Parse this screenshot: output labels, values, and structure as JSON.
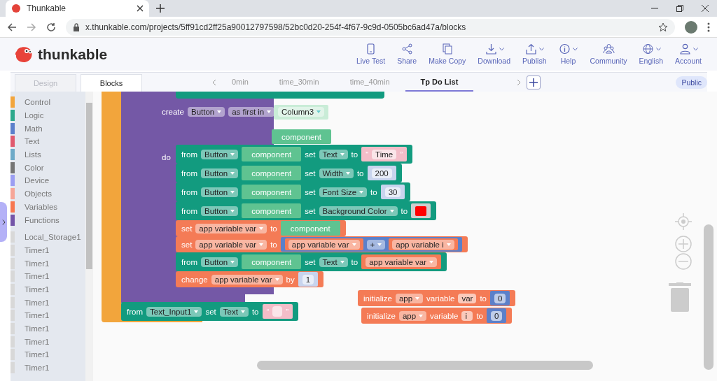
{
  "browser": {
    "tab_title": "Thunkable",
    "url": "x.thunkable.com/projects/5ff91cd2ff25a90012797598/52bc0d20-254f-4f67-9c9d-0505bc6ad47a/blocks"
  },
  "header": {
    "logo": "thunkable",
    "actions": [
      {
        "label": "Live Test",
        "dropdown": false
      },
      {
        "label": "Share",
        "dropdown": false
      },
      {
        "label": "Make Copy",
        "dropdown": false
      },
      {
        "label": "Download",
        "dropdown": true
      },
      {
        "label": "Publish",
        "dropdown": true
      },
      {
        "label": "Help",
        "dropdown": true
      },
      {
        "label": "Community",
        "dropdown": false
      },
      {
        "label": "English",
        "dropdown": true
      },
      {
        "label": "Account",
        "dropdown": true
      }
    ]
  },
  "modes": [
    {
      "label": "Design",
      "selected": false
    },
    {
      "label": "Blocks",
      "selected": true
    }
  ],
  "screens": [
    {
      "label": "0min",
      "selected": false
    },
    {
      "label": "time_30min",
      "selected": false
    },
    {
      "label": "time_40min",
      "selected": false
    },
    {
      "label": "Tp Do List",
      "selected": true
    }
  ],
  "visibility": "Public",
  "sidebar": {
    "categories": [
      {
        "label": "Control",
        "color": "#f2a53c"
      },
      {
        "label": "Logic",
        "color": "#2ea88c"
      },
      {
        "label": "Math",
        "color": "#5b7fcb"
      },
      {
        "label": "Text",
        "color": "#e05a6e"
      },
      {
        "label": "Lists",
        "color": "#6eaac8"
      },
      {
        "label": "Color",
        "color": "#757575"
      },
      {
        "label": "Device",
        "color": "#9b9ef2"
      },
      {
        "label": "Objects",
        "color": "#f6a698"
      },
      {
        "label": "Variables",
        "color": "#f77750"
      },
      {
        "label": "Functions",
        "color": "#7455a8"
      }
    ],
    "components": [
      "Local_Storage1",
      "Timer1",
      "Timer1",
      "Timer1",
      "Timer1",
      "Timer1",
      "Timer1",
      "Timer1",
      "Timer1",
      "Timer1",
      "Timer1"
    ]
  },
  "canvas": {
    "create_block": {
      "header": [
        {
          "kind": "label",
          "text": "create"
        },
        {
          "kind": "dropdown",
          "text": "Button"
        },
        {
          "kind": "dropdown",
          "text": "as first in"
        }
      ],
      "target": {
        "kind": "component_ref",
        "parts": [
          {
            "kind": "dropdown",
            "text": "Column3"
          }
        ]
      },
      "output": {
        "kind": "component_value",
        "parts": [
          {
            "kind": "label",
            "text": "component"
          }
        ]
      },
      "do_label": "do",
      "statements": [
        {
          "kind": "component",
          "parts": [
            {
              "kind": "label",
              "text": "from"
            },
            {
              "kind": "dropdown",
              "text": "Button"
            },
            {
              "kind": "component_value",
              "parts": [
                {
                  "kind": "label",
                  "text": "component"
                }
              ]
            },
            {
              "kind": "label",
              "text": "set"
            },
            {
              "kind": "dropdown",
              "text": "Text"
            },
            {
              "kind": "label",
              "text": "to"
            },
            {
              "kind": "text",
              "parts": [
                {
                  "kind": "label",
                  "text": "“"
                },
                {
                  "kind": "field",
                  "text": "Time"
                },
                {
                  "kind": "label",
                  "text": "”"
                }
              ]
            }
          ]
        },
        {
          "kind": "component",
          "parts": [
            {
              "kind": "label",
              "text": "from"
            },
            {
              "kind": "dropdown",
              "text": "Button"
            },
            {
              "kind": "component_value",
              "parts": [
                {
                  "kind": "label",
                  "text": "component"
                }
              ]
            },
            {
              "kind": "label",
              "text": "set"
            },
            {
              "kind": "dropdown",
              "text": "Width"
            },
            {
              "kind": "label",
              "text": "to"
            },
            {
              "kind": "number",
              "parts": [
                {
                  "kind": "field",
                  "text": "200"
                }
              ]
            }
          ]
        },
        {
          "kind": "component",
          "parts": [
            {
              "kind": "label",
              "text": "from"
            },
            {
              "kind": "dropdown",
              "text": "Button"
            },
            {
              "kind": "component_value",
              "parts": [
                {
                  "kind": "label",
                  "text": "component"
                }
              ]
            },
            {
              "kind": "label",
              "text": "set"
            },
            {
              "kind": "dropdown",
              "text": "Font Size"
            },
            {
              "kind": "label",
              "text": "to"
            },
            {
              "kind": "number",
              "parts": [
                {
                  "kind": "field",
                  "text": "30"
                }
              ]
            }
          ]
        },
        {
          "kind": "component",
          "parts": [
            {
              "kind": "label",
              "text": "from"
            },
            {
              "kind": "dropdown",
              "text": "Button"
            },
            {
              "kind": "component_value",
              "parts": [
                {
                  "kind": "label",
                  "text": "component"
                }
              ]
            },
            {
              "kind": "label",
              "text": "set"
            },
            {
              "kind": "dropdown",
              "text": "Background Color"
            },
            {
              "kind": "label",
              "text": "to"
            },
            {
              "kind": "color",
              "parts": [
                {
                  "kind": "swatch",
                  "color": "#ff0000"
                }
              ]
            }
          ]
        },
        {
          "kind": "variable",
          "parts": [
            {
              "kind": "label",
              "text": "set"
            },
            {
              "kind": "dropdown",
              "text": "app variable var"
            },
            {
              "kind": "label",
              "text": "to"
            },
            {
              "kind": "component_value",
              "parts": [
                {
                  "kind": "label",
                  "text": "component"
                }
              ]
            }
          ]
        },
        {
          "kind": "variable",
          "parts": [
            {
              "kind": "label",
              "text": "set"
            },
            {
              "kind": "dropdown",
              "text": "app variable var"
            },
            {
              "kind": "label",
              "text": "to"
            },
            {
              "kind": "math",
              "parts": [
                {
                  "kind": "variable",
                  "parts": [
                    {
                      "kind": "dropdown",
                      "text": "app variable var"
                    }
                  ]
                },
                {
                  "kind": "dropdown",
                  "text": "+"
                },
                {
                  "kind": "variable",
                  "parts": [
                    {
                      "kind": "dropdown",
                      "text": "app variable i"
                    }
                  ]
                }
              ]
            }
          ]
        },
        {
          "kind": "component",
          "parts": [
            {
              "kind": "label",
              "text": "from"
            },
            {
              "kind": "dropdown",
              "text": "Button"
            },
            {
              "kind": "component_value",
              "parts": [
                {
                  "kind": "label",
                  "text": "component"
                }
              ]
            },
            {
              "kind": "label",
              "text": "set"
            },
            {
              "kind": "dropdown",
              "text": "Text"
            },
            {
              "kind": "label",
              "text": "to"
            },
            {
              "kind": "variable",
              "parts": [
                {
                  "kind": "dropdown",
                  "text": "app variable var"
                }
              ]
            }
          ]
        },
        {
          "kind": "variable",
          "parts": [
            {
              "kind": "label",
              "text": "change"
            },
            {
              "kind": "dropdown",
              "text": "app variable var"
            },
            {
              "kind": "label",
              "text": "by"
            },
            {
              "kind": "number",
              "parts": [
                {
                  "kind": "field",
                  "text": "1"
                }
              ]
            }
          ]
        }
      ]
    },
    "final_statement": {
      "kind": "component",
      "parts": [
        {
          "kind": "label",
          "text": "from"
        },
        {
          "kind": "dropdown",
          "text": "Text_Input1"
        },
        {
          "kind": "label",
          "text": "set"
        },
        {
          "kind": "dropdown",
          "text": "Text"
        },
        {
          "kind": "label",
          "text": "to"
        },
        {
          "kind": "text",
          "parts": [
            {
              "kind": "label",
              "text": "“"
            },
            {
              "kind": "blank"
            },
            {
              "kind": "label",
              "text": "”"
            }
          ]
        }
      ]
    },
    "loose_blocks": [
      {
        "kind": "variable",
        "parts": [
          {
            "kind": "label",
            "text": "initialize"
          },
          {
            "kind": "dropdown",
            "text": "app"
          },
          {
            "kind": "label",
            "text": "variable"
          },
          {
            "kind": "field",
            "text": "var"
          },
          {
            "kind": "label",
            "text": "to"
          },
          {
            "kind": "math",
            "parts": [
              {
                "kind": "field",
                "text": "0"
              }
            ]
          }
        ]
      },
      {
        "kind": "variable",
        "parts": [
          {
            "kind": "label",
            "text": "initialize"
          },
          {
            "kind": "dropdown",
            "text": "app"
          },
          {
            "kind": "label",
            "text": "variable"
          },
          {
            "kind": "field",
            "text": "i"
          },
          {
            "kind": "label",
            "text": "to"
          },
          {
            "kind": "math",
            "parts": [
              {
                "kind": "field",
                "text": "0"
              }
            ]
          }
        ]
      }
    ]
  }
}
